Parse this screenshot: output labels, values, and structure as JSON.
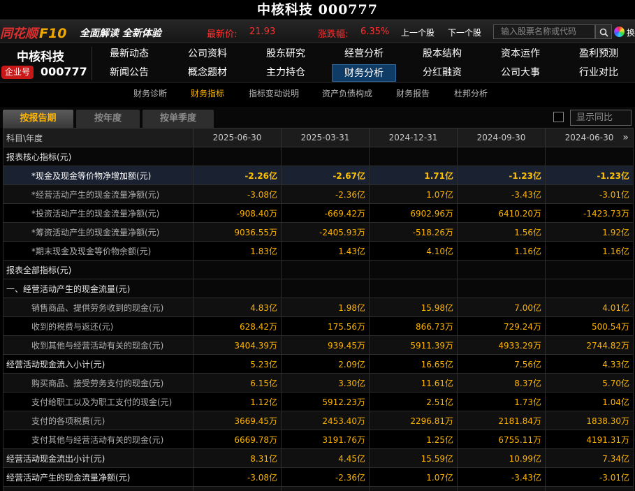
{
  "window": {
    "title": "中核科技 000777"
  },
  "infobar": {
    "logo_text": "同花顺",
    "logo_suffix": "F10",
    "slogan": "全面解读 全新体验",
    "price_label": "最新价:",
    "price_value": "21.93",
    "change_label": "涨跌幅:",
    "change_value": "6.35%",
    "prev_stock": "上一个股",
    "next_stock": "下一个股",
    "search_placeholder": "输入股票名称或代码",
    "skin_label": "换"
  },
  "stock": {
    "name": "中核科技",
    "badge": "企业号",
    "code": "000777"
  },
  "nav": {
    "row1": [
      "最新动态",
      "公司资料",
      "股东研究",
      "经营分析",
      "股本结构",
      "资本运作",
      "盈利预测"
    ],
    "row2": [
      "新闻公告",
      "概念题材",
      "主力持仓",
      "财务分析",
      "分红融资",
      "公司大事",
      "行业对比"
    ],
    "active": "财务分析"
  },
  "subnav": {
    "items": [
      "财务诊断",
      "财务指标",
      "指标变动说明",
      "资产负债构成",
      "财务报告",
      "杜邦分析"
    ],
    "active": "财务指标"
  },
  "tabs": {
    "items": [
      "按报告期",
      "按年度",
      "按单季度"
    ],
    "active": "按报告期",
    "compare_label": "显示同比"
  },
  "table": {
    "header_label": "科目\\年度",
    "periods": [
      "2025-06-30",
      "2025-03-31",
      "2024-12-31",
      "2024-09-30",
      "2024-06-30"
    ],
    "rows": [
      {
        "label": "报表核心指标(元)",
        "type": "section",
        "values": [
          "",
          "",
          "",
          "",
          ""
        ]
      },
      {
        "label": "*现金及现金等价物净增加额(元)",
        "type": "highlight",
        "values": [
          "-2.26亿",
          "-2.67亿",
          "1.71亿",
          "-1.23亿",
          "-1.23亿"
        ]
      },
      {
        "label": "*经营活动产生的现金流量净额(元)",
        "type": "sub",
        "values": [
          "-3.08亿",
          "-2.36亿",
          "1.07亿",
          "-3.43亿",
          "-3.01亿"
        ]
      },
      {
        "label": "*投资活动产生的现金流量净额(元)",
        "type": "sub",
        "values": [
          "-908.40万",
          "-669.42万",
          "6902.96万",
          "6410.20万",
          "-1423.73万"
        ]
      },
      {
        "label": "*筹资活动产生的现金流量净额(元)",
        "type": "sub",
        "values": [
          "9036.55万",
          "-2405.93万",
          "-518.26万",
          "1.56亿",
          "1.92亿"
        ]
      },
      {
        "label": "*期末现金及现金等价物余额(元)",
        "type": "sub",
        "values": [
          "1.83亿",
          "1.43亿",
          "4.10亿",
          "1.16亿",
          "1.16亿"
        ]
      },
      {
        "label": "报表全部指标(元)",
        "type": "section",
        "values": [
          "",
          "",
          "",
          "",
          ""
        ]
      },
      {
        "label": "一、经营活动产生的现金流量(元)",
        "type": "section",
        "values": [
          "",
          "",
          "",
          "",
          ""
        ]
      },
      {
        "label": "销售商品、提供劳务收到的现金(元)",
        "type": "sub",
        "values": [
          "4.83亿",
          "1.98亿",
          "15.98亿",
          "7.00亿",
          "4.01亿"
        ]
      },
      {
        "label": "收到的税费与返还(元)",
        "type": "sub",
        "values": [
          "628.42万",
          "175.56万",
          "866.73万",
          "729.24万",
          "500.54万"
        ]
      },
      {
        "label": "收到其他与经营活动有关的现金(元)",
        "type": "sub",
        "values": [
          "3404.39万",
          "939.45万",
          "5911.39万",
          "4933.29万",
          "2744.82万"
        ]
      },
      {
        "label": "经营活动现金流入小计(元)",
        "type": "bold",
        "values": [
          "5.23亿",
          "2.09亿",
          "16.65亿",
          "7.56亿",
          "4.33亿"
        ]
      },
      {
        "label": "购买商品、接受劳务支付的现金(元)",
        "type": "sub",
        "values": [
          "6.15亿",
          "3.30亿",
          "11.61亿",
          "8.37亿",
          "5.70亿"
        ]
      },
      {
        "label": "支付给职工以及为职工支付的现金(元)",
        "type": "sub",
        "values": [
          "1.12亿",
          "5912.23万",
          "2.51亿",
          "1.73亿",
          "1.04亿"
        ]
      },
      {
        "label": "支付的各项税费(元)",
        "type": "sub",
        "values": [
          "3669.45万",
          "2453.40万",
          "2296.81万",
          "2181.84万",
          "1838.30万"
        ]
      },
      {
        "label": "支付其他与经营活动有关的现金(元)",
        "type": "sub",
        "values": [
          "6669.78万",
          "3191.76万",
          "1.25亿",
          "6755.11万",
          "4191.31万"
        ]
      },
      {
        "label": "经营活动现金流出小计(元)",
        "type": "bold",
        "values": [
          "8.31亿",
          "4.45亿",
          "15.59亿",
          "10.99亿",
          "7.34亿"
        ]
      },
      {
        "label": "经营活动产生的现金流量净额(元)",
        "type": "bold",
        "values": [
          "-3.08亿",
          "-2.36亿",
          "1.07亿",
          "-3.43亿",
          "-3.01亿"
        ]
      },
      {
        "label": "",
        "type": "bold",
        "values": [
          "",
          "",
          "",
          "",
          ""
        ]
      }
    ]
  },
  "colors": {
    "accent": "#ffb400",
    "up_red": "#ff3030",
    "active_nav_bg": "#0f3c66"
  }
}
